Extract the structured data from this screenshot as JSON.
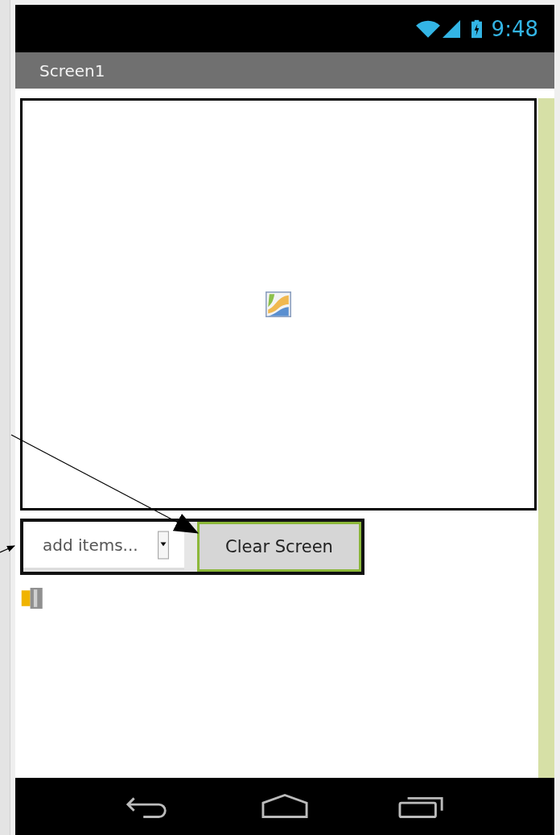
{
  "status_bar": {
    "time": "9:48"
  },
  "title_bar": {
    "title": "Screen1"
  },
  "controls": {
    "list_picker": {
      "label": "add items..."
    },
    "button": {
      "label": "Clear Screen"
    }
  }
}
